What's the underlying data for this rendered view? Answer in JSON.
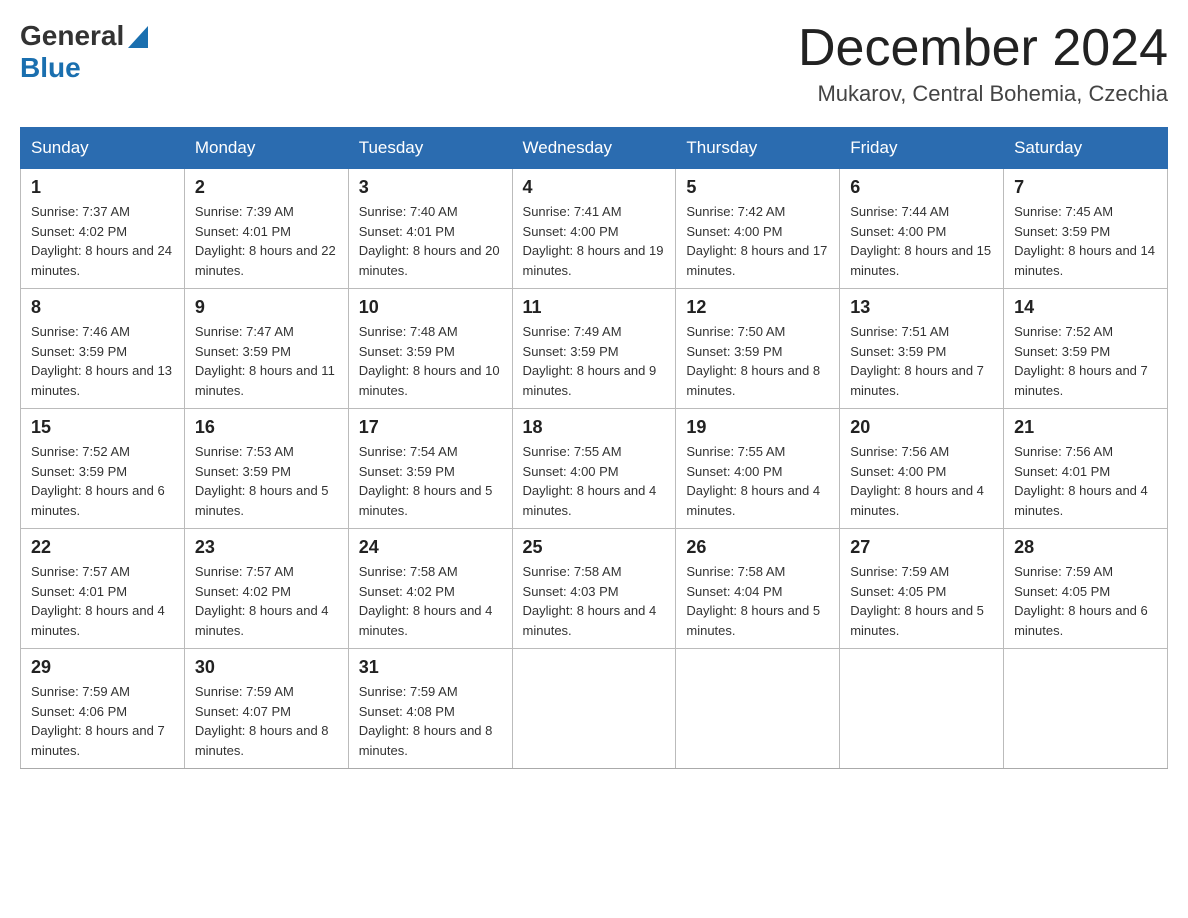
{
  "header": {
    "logo": {
      "general": "General",
      "blue": "Blue"
    },
    "title": "December 2024",
    "location": "Mukarov, Central Bohemia, Czechia"
  },
  "weekdays": [
    "Sunday",
    "Monday",
    "Tuesday",
    "Wednesday",
    "Thursday",
    "Friday",
    "Saturday"
  ],
  "weeks": [
    [
      {
        "day": "1",
        "sunrise": "7:37 AM",
        "sunset": "4:02 PM",
        "daylight": "8 hours and 24 minutes."
      },
      {
        "day": "2",
        "sunrise": "7:39 AM",
        "sunset": "4:01 PM",
        "daylight": "8 hours and 22 minutes."
      },
      {
        "day": "3",
        "sunrise": "7:40 AM",
        "sunset": "4:01 PM",
        "daylight": "8 hours and 20 minutes."
      },
      {
        "day": "4",
        "sunrise": "7:41 AM",
        "sunset": "4:00 PM",
        "daylight": "8 hours and 19 minutes."
      },
      {
        "day": "5",
        "sunrise": "7:42 AM",
        "sunset": "4:00 PM",
        "daylight": "8 hours and 17 minutes."
      },
      {
        "day": "6",
        "sunrise": "7:44 AM",
        "sunset": "4:00 PM",
        "daylight": "8 hours and 15 minutes."
      },
      {
        "day": "7",
        "sunrise": "7:45 AM",
        "sunset": "3:59 PM",
        "daylight": "8 hours and 14 minutes."
      }
    ],
    [
      {
        "day": "8",
        "sunrise": "7:46 AM",
        "sunset": "3:59 PM",
        "daylight": "8 hours and 13 minutes."
      },
      {
        "day": "9",
        "sunrise": "7:47 AM",
        "sunset": "3:59 PM",
        "daylight": "8 hours and 11 minutes."
      },
      {
        "day": "10",
        "sunrise": "7:48 AM",
        "sunset": "3:59 PM",
        "daylight": "8 hours and 10 minutes."
      },
      {
        "day": "11",
        "sunrise": "7:49 AM",
        "sunset": "3:59 PM",
        "daylight": "8 hours and 9 minutes."
      },
      {
        "day": "12",
        "sunrise": "7:50 AM",
        "sunset": "3:59 PM",
        "daylight": "8 hours and 8 minutes."
      },
      {
        "day": "13",
        "sunrise": "7:51 AM",
        "sunset": "3:59 PM",
        "daylight": "8 hours and 7 minutes."
      },
      {
        "day": "14",
        "sunrise": "7:52 AM",
        "sunset": "3:59 PM",
        "daylight": "8 hours and 7 minutes."
      }
    ],
    [
      {
        "day": "15",
        "sunrise": "7:52 AM",
        "sunset": "3:59 PM",
        "daylight": "8 hours and 6 minutes."
      },
      {
        "day": "16",
        "sunrise": "7:53 AM",
        "sunset": "3:59 PM",
        "daylight": "8 hours and 5 minutes."
      },
      {
        "day": "17",
        "sunrise": "7:54 AM",
        "sunset": "3:59 PM",
        "daylight": "8 hours and 5 minutes."
      },
      {
        "day": "18",
        "sunrise": "7:55 AM",
        "sunset": "4:00 PM",
        "daylight": "8 hours and 4 minutes."
      },
      {
        "day": "19",
        "sunrise": "7:55 AM",
        "sunset": "4:00 PM",
        "daylight": "8 hours and 4 minutes."
      },
      {
        "day": "20",
        "sunrise": "7:56 AM",
        "sunset": "4:00 PM",
        "daylight": "8 hours and 4 minutes."
      },
      {
        "day": "21",
        "sunrise": "7:56 AM",
        "sunset": "4:01 PM",
        "daylight": "8 hours and 4 minutes."
      }
    ],
    [
      {
        "day": "22",
        "sunrise": "7:57 AM",
        "sunset": "4:01 PM",
        "daylight": "8 hours and 4 minutes."
      },
      {
        "day": "23",
        "sunrise": "7:57 AM",
        "sunset": "4:02 PM",
        "daylight": "8 hours and 4 minutes."
      },
      {
        "day": "24",
        "sunrise": "7:58 AM",
        "sunset": "4:02 PM",
        "daylight": "8 hours and 4 minutes."
      },
      {
        "day": "25",
        "sunrise": "7:58 AM",
        "sunset": "4:03 PM",
        "daylight": "8 hours and 4 minutes."
      },
      {
        "day": "26",
        "sunrise": "7:58 AM",
        "sunset": "4:04 PM",
        "daylight": "8 hours and 5 minutes."
      },
      {
        "day": "27",
        "sunrise": "7:59 AM",
        "sunset": "4:05 PM",
        "daylight": "8 hours and 5 minutes."
      },
      {
        "day": "28",
        "sunrise": "7:59 AM",
        "sunset": "4:05 PM",
        "daylight": "8 hours and 6 minutes."
      }
    ],
    [
      {
        "day": "29",
        "sunrise": "7:59 AM",
        "sunset": "4:06 PM",
        "daylight": "8 hours and 7 minutes."
      },
      {
        "day": "30",
        "sunrise": "7:59 AM",
        "sunset": "4:07 PM",
        "daylight": "8 hours and 8 minutes."
      },
      {
        "day": "31",
        "sunrise": "7:59 AM",
        "sunset": "4:08 PM",
        "daylight": "8 hours and 8 minutes."
      },
      null,
      null,
      null,
      null
    ]
  ]
}
